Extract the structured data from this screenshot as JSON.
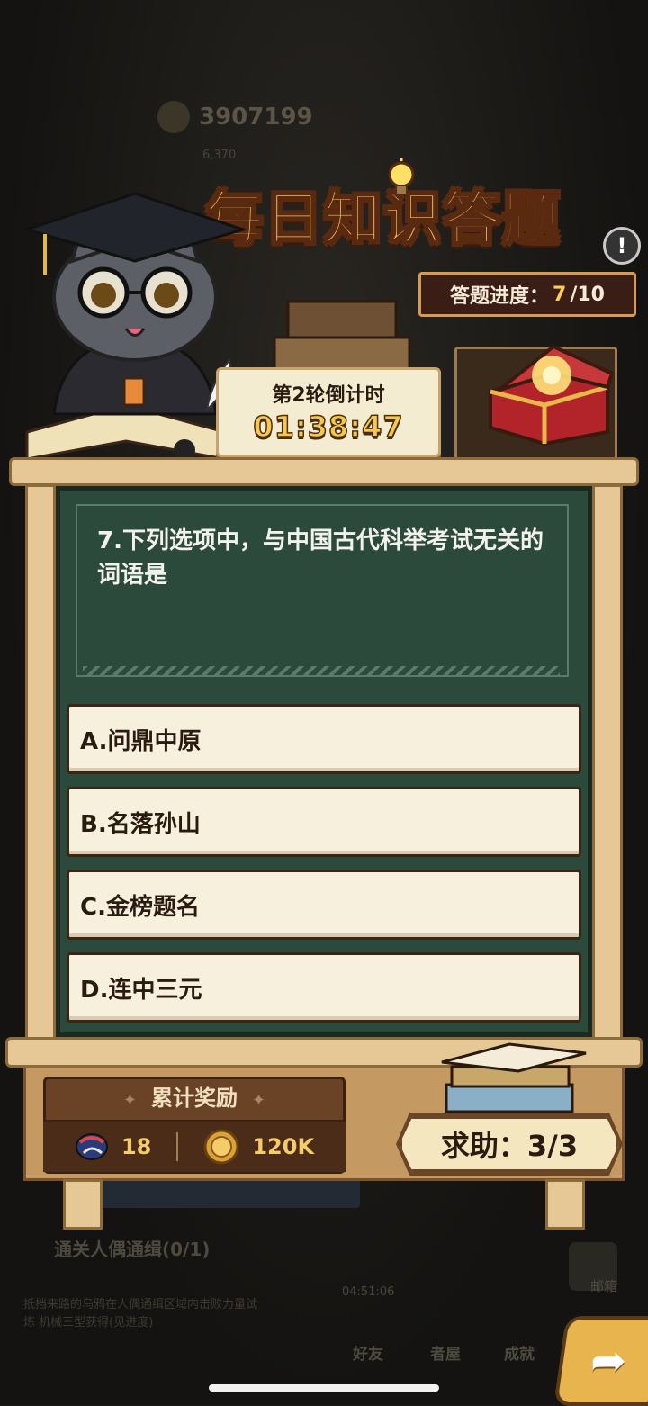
{
  "background": {
    "score": "3907199",
    "sub_value": "6,370",
    "task_label": "通关人偶通缉(0/1)",
    "task_desc": "抵挡来路的乌鸦在人偶通缉区域内击败力量试炼 机械三型获得(见进度)",
    "task_timer": "04:51:06",
    "nav": [
      "好友",
      "者屋",
      "成就"
    ],
    "mail_label": "邮箱"
  },
  "quiz": {
    "title": "每日知识答题",
    "progress_label": "答题进度：",
    "progress_current": "7",
    "progress_total": "/10",
    "countdown_label": "第2轮倒计时",
    "countdown_time": "01:38:47",
    "question": "7.下列选项中，与中国古代科举考试无关的词语是",
    "options": [
      {
        "label": "A.问鼎中原"
      },
      {
        "label": "B.名落孙山"
      },
      {
        "label": "C.金榜题名"
      },
      {
        "label": "D.连中三元"
      }
    ],
    "reward_title": "累计奖励",
    "reward_gem": "18",
    "reward_coin": "120K",
    "help_label": "求助：3/3"
  },
  "colors": {
    "title_gold": "#f4c66a",
    "board_green": "#2c4a3c",
    "option_bg": "#f7f0dd",
    "wood": "#e6c896",
    "reward_text": "#f4cd6a"
  },
  "icons": [
    "bulb-icon",
    "info-icon",
    "treasure-chest-icon",
    "gem-icon",
    "coin-icon",
    "next-arrow-icon"
  ]
}
